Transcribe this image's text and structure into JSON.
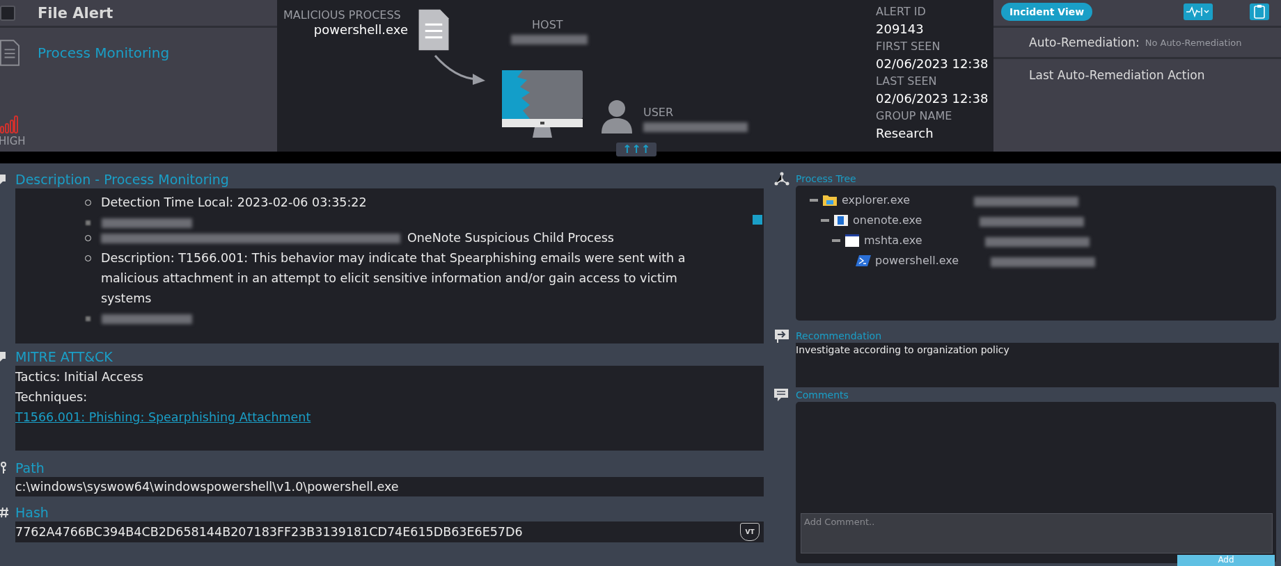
{
  "header": {
    "selected": false,
    "title": "File Alert",
    "category": "Process Monitoring",
    "severity": {
      "label": "HIGH",
      "color": "#d0312d"
    }
  },
  "graph": {
    "process": {
      "label": "MALICIOUS PROCESS",
      "value": "powershell.exe"
    },
    "host": {
      "label": "HOST",
      "redacted": true
    },
    "user": {
      "label": "USER",
      "redacted": true
    },
    "expand_label": "↑↑↑"
  },
  "alert_info": [
    {
      "label": "ALERT ID",
      "value": "209143"
    },
    {
      "label": "FIRST SEEN",
      "value": "02/06/2023 12:38"
    },
    {
      "label": "LAST SEEN",
      "value": "02/06/2023 12:38"
    },
    {
      "label": "GROUP NAME",
      "value": "Research"
    }
  ],
  "actions": {
    "view_button": "Incident View",
    "remediation_label": "Auto-Remediation:",
    "remediation_value": "No Auto-Remediation",
    "last_action": "Last Auto-Remediation Action"
  },
  "description": {
    "title": "Description - Process Monitoring",
    "items": [
      {
        "kind": "text",
        "text": "Detection Time Local: 2023-02-06 03:35:22"
      },
      {
        "kind": "redacted"
      },
      {
        "kind": "mixed",
        "text": "OneNote Suspicious Child Process"
      },
      {
        "kind": "text",
        "text": "Description: T1566.001: This behavior may indicate that Spearphishing emails were sent with a malicious attachment in an attempt to elicit sensitive information and/or gain access to victim systems"
      },
      {
        "kind": "redacted"
      }
    ]
  },
  "mitre": {
    "title": "MITRE ATT&CK",
    "tactics": "Tactics: Initial Access",
    "techniques_label": "Techniques:",
    "technique_link": "T1566.001: Phishing: Spearphishing Attachment"
  },
  "path": {
    "title": "Path",
    "value": "c:\\windows\\syswow64\\windowspowershell\\v1.0\\powershell.exe"
  },
  "hash": {
    "title": "Hash",
    "value": "7762A4766BC394B4CB2D658144B207183FF23B3139181CD74E615DB63E6E57D6",
    "badge": "VT"
  },
  "process_tree": {
    "title": "Process Tree",
    "nodes": [
      {
        "name": "explorer.exe",
        "kind": "folder",
        "expanded": true,
        "user_redacted": true,
        "children": [
          {
            "name": "onenote.exe",
            "kind": "app",
            "expanded": true,
            "user_redacted": true,
            "children": [
              {
                "name": "mshta.exe",
                "kind": "window",
                "expanded": true,
                "user_redacted": true,
                "children": [
                  {
                    "name": "powershell.exe",
                    "kind": "shell",
                    "user_redacted": true
                  }
                ]
              }
            ]
          }
        ]
      }
    ]
  },
  "recommendation": {
    "title": "Recommendation",
    "text": "Investigate according to organization policy"
  },
  "comments": {
    "title": "Comments",
    "placeholder": "Add Comment..",
    "button": "Add"
  }
}
